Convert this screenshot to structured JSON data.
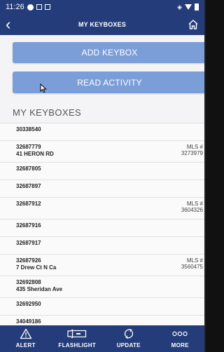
{
  "status": {
    "time": "11:26"
  },
  "header": {
    "title": "MY KEYBOXES"
  },
  "buttons": {
    "add": "ADD KEYBOX",
    "read": "READ ACTIVITY"
  },
  "section_title": "MY KEYBOXES",
  "keyboxes": [
    {
      "number": "30338540",
      "address": "",
      "mls_label": "",
      "mls": ""
    },
    {
      "number": "32687779",
      "address": "41 HERON RD",
      "mls_label": "MLS #",
      "mls": "3273979"
    },
    {
      "number": "32687805",
      "address": "",
      "mls_label": "",
      "mls": ""
    },
    {
      "number": "32687897",
      "address": "",
      "mls_label": "",
      "mls": ""
    },
    {
      "number": "32687912",
      "address": "",
      "mls_label": "MLS #",
      "mls": "3604326"
    },
    {
      "number": "32687916",
      "address": "",
      "mls_label": "",
      "mls": ""
    },
    {
      "number": "32687917",
      "address": "",
      "mls_label": "",
      "mls": ""
    },
    {
      "number": "32687926",
      "address": "7 Drew Ct N Ca",
      "mls_label": "MLS #",
      "mls": "3560475"
    },
    {
      "number": "32692808",
      "address": "435 Sheridan Ave",
      "mls_label": "",
      "mls": ""
    },
    {
      "number": "32692950",
      "address": "",
      "mls_label": "",
      "mls": ""
    },
    {
      "number": "34049186",
      "address": "",
      "mls_label": "",
      "mls": ""
    }
  ],
  "tabs": [
    {
      "label": "ALERT",
      "icon": "alert-icon"
    },
    {
      "label": "FLASHLIGHT",
      "icon": "flashlight-icon"
    },
    {
      "label": "UPDATE",
      "icon": "sync-icon"
    },
    {
      "label": "MORE",
      "icon": "more-icon"
    }
  ],
  "colors": {
    "primary": "#243d7a",
    "button": "#7c9ed8",
    "background": "#f4f4f6"
  }
}
